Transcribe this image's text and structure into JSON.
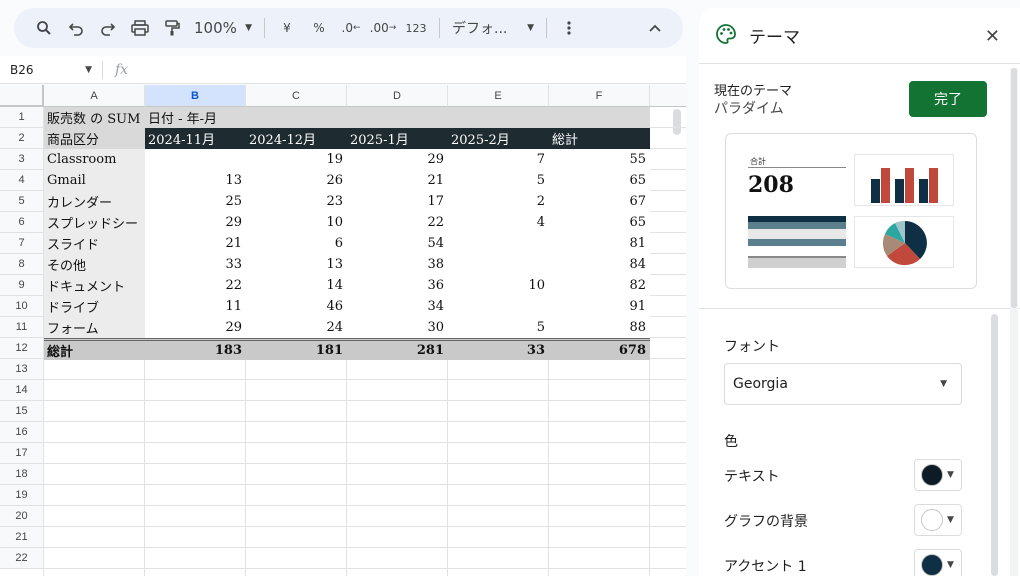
{
  "toolbar": {
    "zoom": "100%",
    "currency": "¥",
    "percent": "%",
    "dec_decrease": ".0",
    "dec_increase": ".00",
    "number_format": "123",
    "font_name": "デフォ..."
  },
  "formula_bar": {
    "cell_ref": "B26",
    "fx": "fx"
  },
  "columns": [
    "A",
    "B",
    "C",
    "D",
    "E",
    "F"
  ],
  "rows": [
    "1",
    "2",
    "3",
    "4",
    "5",
    "6",
    "7",
    "8",
    "9",
    "10",
    "11",
    "12",
    "13",
    "14",
    "15",
    "16",
    "17",
    "18",
    "19",
    "20",
    "21",
    "22"
  ],
  "pivot": {
    "title": "販売数 の SUM",
    "col_group": "日付 - 年-月",
    "row_header": "商品区分",
    "col_headers": [
      "2024-11月",
      "2024-12月",
      "2025-1月",
      "2025-2月",
      "総計"
    ],
    "data": [
      {
        "label": "Classroom",
        "values": [
          "",
          "19",
          "29",
          "7",
          "55"
        ]
      },
      {
        "label": "Gmail",
        "values": [
          "13",
          "26",
          "21",
          "5",
          "65"
        ]
      },
      {
        "label": "カレンダー",
        "values": [
          "25",
          "23",
          "17",
          "2",
          "67"
        ]
      },
      {
        "label": "スプレッドシー",
        "values": [
          "29",
          "10",
          "22",
          "4",
          "65"
        ]
      },
      {
        "label": "スライド",
        "values": [
          "21",
          "6",
          "54",
          "",
          "81"
        ]
      },
      {
        "label": "その他",
        "values": [
          "33",
          "13",
          "38",
          "",
          "84"
        ]
      },
      {
        "label": "ドキュメント",
        "values": [
          "22",
          "14",
          "36",
          "10",
          "82"
        ]
      },
      {
        "label": "ドライブ",
        "values": [
          "11",
          "46",
          "34",
          "",
          "91"
        ]
      },
      {
        "label": "フォーム",
        "values": [
          "29",
          "24",
          "30",
          "5",
          "88"
        ]
      }
    ],
    "total": {
      "label": "総計",
      "values": [
        "183",
        "181",
        "281",
        "33",
        "678"
      ]
    }
  },
  "panel": {
    "title": "テーマ",
    "current_label": "現在のテーマ",
    "current_name": "パラダイム",
    "done": "完了",
    "preview_total_label": "合計",
    "preview_total_value": "208",
    "font_label": "フォント",
    "font_value": "Georgia",
    "color_label": "色",
    "text_color_label": "テキスト",
    "chart_bg_label": "グラフの背景",
    "accent1_label": "アクセント 1",
    "colors": {
      "text": "#0d1b26",
      "chart_bg": "#ffffff",
      "accent1": "#0e2f44",
      "accent2": "#c0493b",
      "accent3": "#5c7f8e",
      "done": "#137333"
    }
  }
}
